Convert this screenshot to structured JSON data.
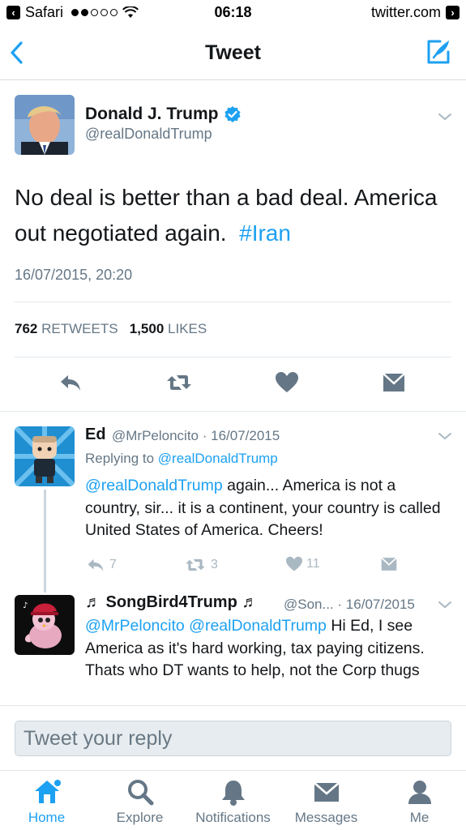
{
  "status_bar": {
    "carrier": "Safari",
    "time": "06:18",
    "url": "twitter.com"
  },
  "nav": {
    "title": "Tweet"
  },
  "main_tweet": {
    "author_name": "Donald J. Trump",
    "author_handle": "@realDonaldTrump",
    "text_main": "No deal is better than a bad deal. America out negotiated again.",
    "hashtag": "#Iran",
    "timestamp": "16/07/2015, 20:20",
    "retweets_count": "762",
    "retweets_label": "RETWEETS",
    "likes_count": "1,500",
    "likes_label": "LIKES"
  },
  "replies": [
    {
      "name": "Ed",
      "handle": "@MrPeloncito",
      "date": "· 16/07/2015",
      "replying_prefix": "Replying to",
      "replying_to": "@realDonaldTrump",
      "mention": "@realDonaldTrump",
      "text": "again... America is not a country, sir... it is a continent, your country is called United States of America. Cheers!",
      "reply_count": "7",
      "retweet_count": "3",
      "like_count": "11"
    },
    {
      "name": "♬ SongBird4Trump ♬",
      "handle": "@Son...",
      "date": "· 16/07/2015",
      "mentions": "@MrPeloncito @realDonaldTrump",
      "text": "Hi Ed, I see America as it's hard working, tax paying citizens. Thats who DT wants to help, not the Corp thugs"
    }
  ],
  "reply_box": {
    "placeholder": "Tweet your reply"
  },
  "tabs": [
    {
      "label": "Home",
      "icon": "home-icon"
    },
    {
      "label": "Explore",
      "icon": "search-icon"
    },
    {
      "label": "Notifications",
      "icon": "bell-icon"
    },
    {
      "label": "Messages",
      "icon": "envelope-icon"
    },
    {
      "label": "Me",
      "icon": "person-icon"
    }
  ],
  "colors": {
    "accent": "#1da1f2",
    "secondary_text": "#657786",
    "muted_icon": "#aab8c2"
  }
}
